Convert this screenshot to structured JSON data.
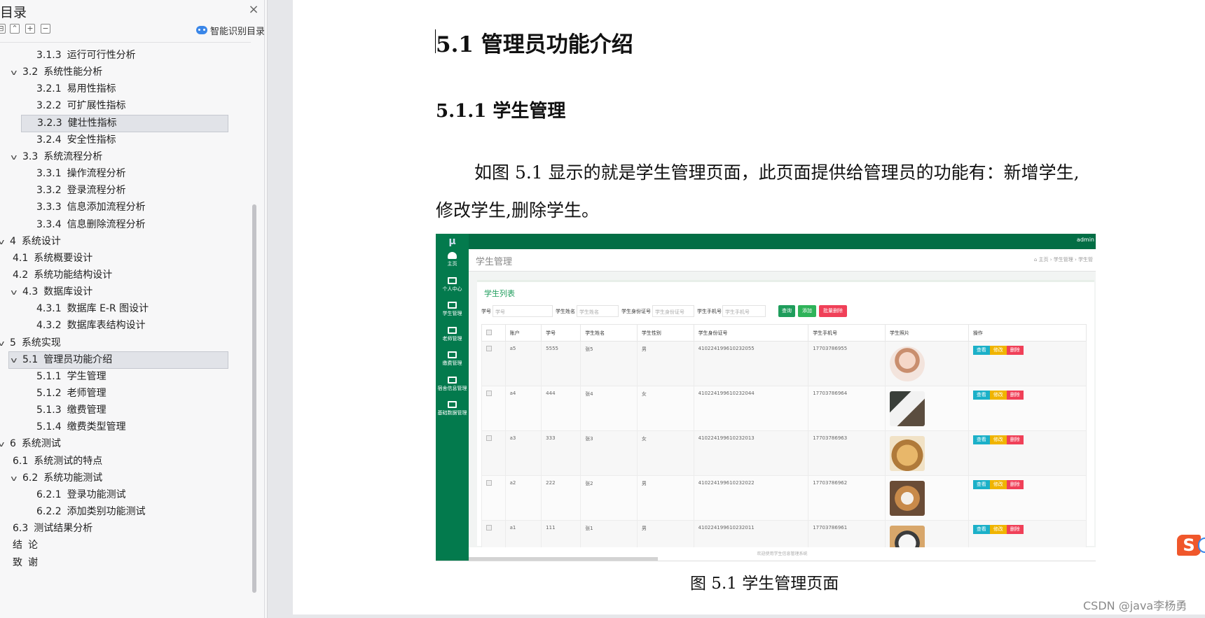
{
  "toc": {
    "title": "目录",
    "close": "×",
    "tools": [
      "⊟",
      "⌃",
      "+",
      "−"
    ],
    "smart": "智能识别目录",
    "items": [
      {
        "num": "3.1.3",
        "text": "运行可行性分析",
        "level": 3
      },
      {
        "num": "3.2",
        "text": "系统性能分析",
        "level": 2,
        "expanded": true
      },
      {
        "num": "3.2.1",
        "text": "易用性指标",
        "level": 3
      },
      {
        "num": "3.2.2",
        "text": "可扩展性指标",
        "level": 3
      },
      {
        "num": "3.2.3",
        "text": "健壮性指标",
        "level": 3,
        "selected": true
      },
      {
        "num": "3.2.4",
        "text": "安全性指标",
        "level": 3
      },
      {
        "num": "3.3",
        "text": "系统流程分析",
        "level": 2,
        "expanded": true
      },
      {
        "num": "3.3.1",
        "text": "操作流程分析",
        "level": 3
      },
      {
        "num": "3.3.2",
        "text": "登录流程分析",
        "level": 3
      },
      {
        "num": "3.3.3",
        "text": "信息添加流程分析",
        "level": 3
      },
      {
        "num": "3.3.4",
        "text": "信息删除流程分析",
        "level": 3
      },
      {
        "num": "4",
        "text": "系统设计",
        "level": 1,
        "expanded": true
      },
      {
        "num": "4.1",
        "text": "系统概要设计",
        "level": 2
      },
      {
        "num": "4.2",
        "text": "系统功能结构设计",
        "level": 2
      },
      {
        "num": "4.3",
        "text": "数据库设计",
        "level": 2,
        "expanded": true
      },
      {
        "num": "4.3.1",
        "text": "数据库 E-R 图设计",
        "level": 3
      },
      {
        "num": "4.3.2",
        "text": "数据库表结构设计",
        "level": 3
      },
      {
        "num": "5",
        "text": "系统实现",
        "level": 1,
        "expanded": true
      },
      {
        "num": "5.1",
        "text": "管理员功能介绍",
        "level": 2,
        "expanded": true,
        "selected": true
      },
      {
        "num": "5.1.1",
        "text": "学生管理",
        "level": 3
      },
      {
        "num": "5.1.2",
        "text": "老师管理",
        "level": 3
      },
      {
        "num": "5.1.3",
        "text": "缴费管理",
        "level": 3
      },
      {
        "num": "5.1.4",
        "text": "缴费类型管理",
        "level": 3
      },
      {
        "num": "6",
        "text": "系统测试",
        "level": 1,
        "expanded": true
      },
      {
        "num": "6.1",
        "text": "系统测试的特点",
        "level": 2
      },
      {
        "num": "6.2",
        "text": "系统功能测试",
        "level": 2,
        "expanded": true
      },
      {
        "num": "6.2.1",
        "text": "登录功能测试",
        "level": 3
      },
      {
        "num": "6.2.2",
        "text": "添加类别功能测试",
        "level": 3
      },
      {
        "num": "6.3",
        "text": "测试结果分析",
        "level": 2
      },
      {
        "num": "结",
        "text": "论",
        "level": 1,
        "nochev": true
      },
      {
        "num": "致",
        "text": "谢",
        "level": 1,
        "nochev": true
      }
    ]
  },
  "doc": {
    "h1": "5.1  管理员功能介绍",
    "h2": "5.1.1  学生管理",
    "paragraph": "如图 5.1 显示的就是学生管理页面，此页面提供给管理员的功能有：新增学生,修改学生,删除学生。",
    "caption": "图 5.1  学生管理页面",
    "watermark": "CSDN @java李杨勇",
    "ime_logo": "S"
  },
  "figure": {
    "logo": "μ",
    "admin": "admin",
    "page_title": "学生管理",
    "breadcrumb": "⌂ 主页  ›  学生管理  ›  学生管",
    "card_title": "学生列表",
    "nav": [
      "主页",
      "个人中心",
      "学生管理",
      "老师管理",
      "缴费管理",
      "宿舍信息管理",
      "基础数据管理"
    ],
    "search": {
      "labels": [
        "学号",
        "学生姓名",
        "学生身份证号",
        "学生手机号"
      ],
      "placeholders": [
        "学号",
        "学生姓名",
        "学生身份证号",
        "学生手机号"
      ],
      "buttons": [
        "查询",
        "添加",
        "批量删除"
      ],
      "button_colors": [
        "#1f9d5c",
        "#2fb35a",
        "#f04058"
      ]
    },
    "columns": [
      "",
      "账户",
      "学号",
      "学生姓名",
      "学生性别",
      "学生身份证号",
      "学生手机号",
      "学生照片",
      "操作"
    ],
    "rows": [
      [
        "a5",
        "5555",
        "张5",
        "男",
        "410224199610232055",
        "17703786955"
      ],
      [
        "a4",
        "444",
        "张4",
        "女",
        "410224199610232044",
        "17703786964"
      ],
      [
        "a3",
        "333",
        "张3",
        "女",
        "410224199610232013",
        "17703786963"
      ],
      [
        "a2",
        "222",
        "张2",
        "男",
        "410224199610232022",
        "17703786962"
      ],
      [
        "a1",
        "111",
        "张1",
        "男",
        "410224199610232011",
        "17703786961"
      ]
    ],
    "actions": [
      "查看",
      "修改",
      "删除"
    ],
    "footer": "欢迎使用学生信息管理系统"
  }
}
